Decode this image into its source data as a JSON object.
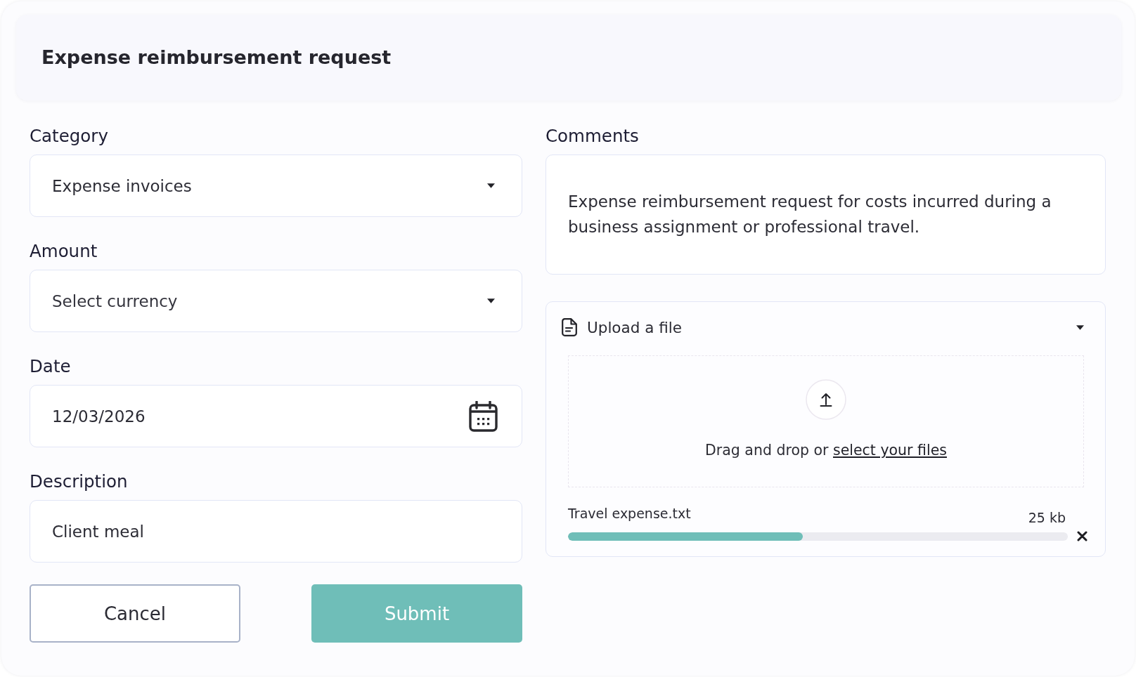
{
  "header": {
    "title": "Expense reimbursement request"
  },
  "form": {
    "fields": [
      {
        "kind": "select",
        "label": "Category",
        "value": "Expense invoices"
      },
      {
        "kind": "select",
        "label": "Amount",
        "placeholder": "Select currency"
      },
      {
        "kind": "date",
        "label": "Date",
        "value": "12/03/2026"
      },
      {
        "kind": "text",
        "label": "Description",
        "value": "Client meal"
      }
    ],
    "buttons": [
      {
        "kind": "secondary",
        "label": "Cancel"
      },
      {
        "kind": "primary",
        "label": "Submit"
      }
    ]
  },
  "comments": {
    "label": "Comments",
    "value": "Expense reimbursement request for costs incurred during a business assignment or professional travel."
  },
  "upload": {
    "title": "Upload a file",
    "expanded": true,
    "dropzone": {
      "text": "Drag and drop or",
      "link": "select your files"
    },
    "file": {
      "name": "Travel expense.txt",
      "size": "25 kb",
      "level": 0.47
    }
  }
}
